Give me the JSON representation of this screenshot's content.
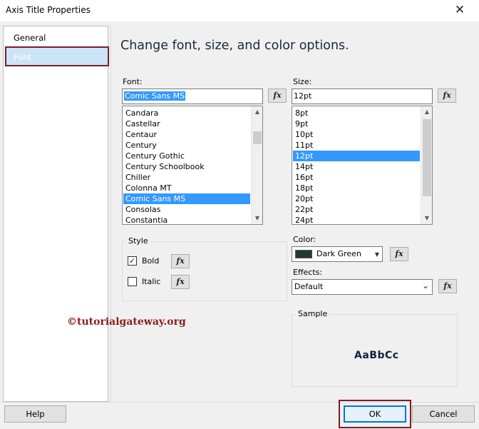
{
  "window": {
    "title": "Axis Title Properties",
    "close_glyph": "✕"
  },
  "nav": {
    "items": [
      {
        "label": "General",
        "selected": false
      },
      {
        "label": "Font",
        "selected": true
      }
    ]
  },
  "main": {
    "heading": "Change font, size, and color options."
  },
  "font": {
    "label": "Font:",
    "value": "Comic Sans MS",
    "fx_label": "fx",
    "options": [
      "Candara",
      "Castellar",
      "Centaur",
      "Century",
      "Century Gothic",
      "Century Schoolbook",
      "Chiller",
      "Colonna MT",
      "Comic Sans MS",
      "Consolas",
      "Constantia"
    ],
    "selected": "Comic Sans MS"
  },
  "size": {
    "label": "Size:",
    "value": "12pt",
    "fx_label": "fx",
    "options": [
      "8pt",
      "9pt",
      "10pt",
      "11pt",
      "12pt",
      "14pt",
      "16pt",
      "18pt",
      "20pt",
      "22pt",
      "24pt"
    ],
    "selected": "12pt"
  },
  "style": {
    "group_label": "Style",
    "bold": {
      "label": "Bold",
      "checked": true,
      "check_glyph": "✓"
    },
    "italic": {
      "label": "Italic",
      "checked": false
    },
    "fx_label": "fx"
  },
  "color": {
    "label": "Color:",
    "value": "Dark Green",
    "swatch": "#1f3a32",
    "fx_label": "fx"
  },
  "effects": {
    "label": "Effects:",
    "value": "Default",
    "fx_label": "fx"
  },
  "sample": {
    "group_label": "Sample",
    "text": "AaBbCc"
  },
  "watermark": "©tutorialgateway.org",
  "buttons": {
    "help": "Help",
    "ok": "OK",
    "cancel": "Cancel"
  },
  "icons": {
    "scroll_up": "▲",
    "scroll_down": "▼",
    "dropdown": "⌄"
  },
  "colors": {
    "selection": "#3399ff",
    "highlight_frame": "#7b1c2a",
    "ok_border": "#0078d7"
  }
}
